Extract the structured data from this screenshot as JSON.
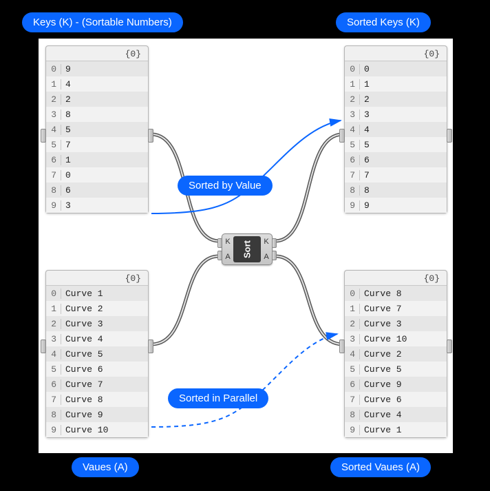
{
  "labels": {
    "keys": "Keys (K) - (Sortable Numbers)",
    "sortedKeys": "Sorted Keys (K)",
    "values": "Vaues (A)",
    "sortedValues": "Sorted Vaues (A)",
    "sortedByValue": "Sorted by Value",
    "sortedInParallel": "Sorted in Parallel"
  },
  "panelHeader": "{0}",
  "component": {
    "name": "Sort",
    "ports": {
      "inK": "K",
      "inA": "A",
      "outK": "K",
      "outA": "A"
    }
  },
  "panels": {
    "keys": [
      {
        "i": "0",
        "v": "9"
      },
      {
        "i": "1",
        "v": "4"
      },
      {
        "i": "2",
        "v": "2"
      },
      {
        "i": "3",
        "v": "8"
      },
      {
        "i": "4",
        "v": "5"
      },
      {
        "i": "5",
        "v": "7"
      },
      {
        "i": "6",
        "v": "1"
      },
      {
        "i": "7",
        "v": "0"
      },
      {
        "i": "8",
        "v": "6"
      },
      {
        "i": "9",
        "v": "3"
      }
    ],
    "sortedKeys": [
      {
        "i": "0",
        "v": "0"
      },
      {
        "i": "1",
        "v": "1"
      },
      {
        "i": "2",
        "v": "2"
      },
      {
        "i": "3",
        "v": "3"
      },
      {
        "i": "4",
        "v": "4"
      },
      {
        "i": "5",
        "v": "5"
      },
      {
        "i": "6",
        "v": "6"
      },
      {
        "i": "7",
        "v": "7"
      },
      {
        "i": "8",
        "v": "8"
      },
      {
        "i": "9",
        "v": "9"
      }
    ],
    "values": [
      {
        "i": "0",
        "v": "Curve 1"
      },
      {
        "i": "1",
        "v": "Curve 2"
      },
      {
        "i": "2",
        "v": "Curve 3"
      },
      {
        "i": "3",
        "v": "Curve 4"
      },
      {
        "i": "4",
        "v": "Curve 5"
      },
      {
        "i": "5",
        "v": "Curve 6"
      },
      {
        "i": "6",
        "v": "Curve 7"
      },
      {
        "i": "7",
        "v": "Curve 8"
      },
      {
        "i": "8",
        "v": "Curve 9"
      },
      {
        "i": "9",
        "v": "Curve 10"
      }
    ],
    "sortedValues": [
      {
        "i": "0",
        "v": "Curve 8"
      },
      {
        "i": "1",
        "v": "Curve 7"
      },
      {
        "i": "2",
        "v": "Curve 3"
      },
      {
        "i": "3",
        "v": "Curve 10"
      },
      {
        "i": "4",
        "v": "Curve 2"
      },
      {
        "i": "5",
        "v": "Curve 5"
      },
      {
        "i": "6",
        "v": "Curve 9"
      },
      {
        "i": "7",
        "v": "Curve 6"
      },
      {
        "i": "8",
        "v": "Curve 4"
      },
      {
        "i": "9",
        "v": "Curve 1"
      }
    ]
  }
}
